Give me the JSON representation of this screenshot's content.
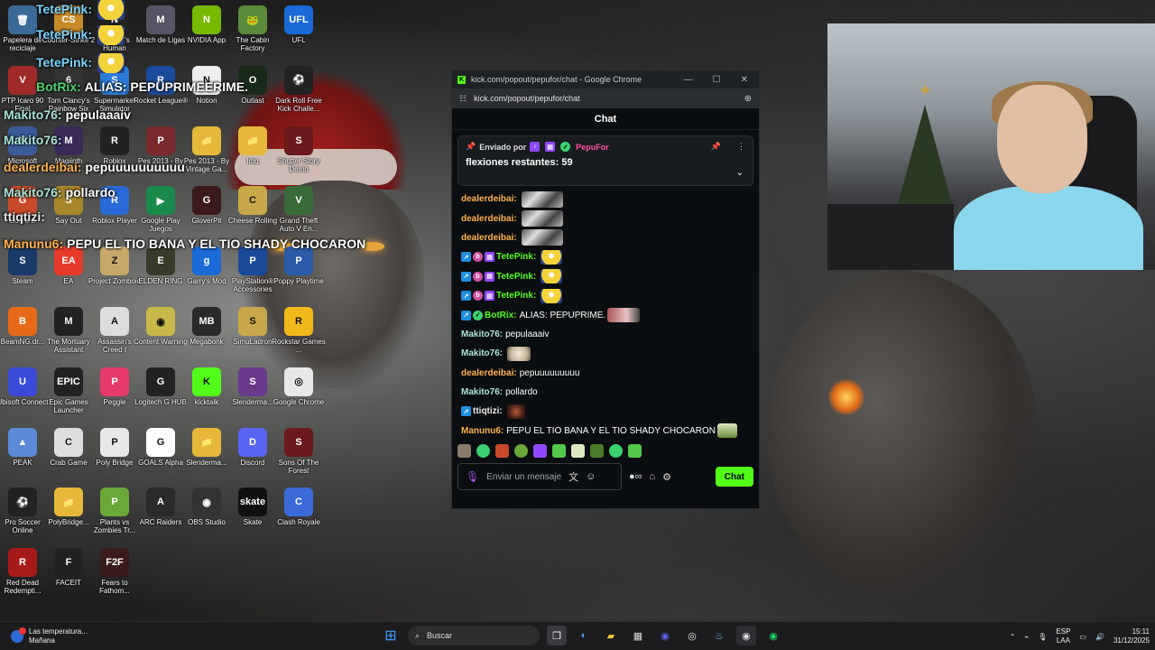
{
  "overlay_chat": [
    {
      "user": "TetePink:",
      "text": "",
      "color": "#7ad6ff",
      "emote": true
    },
    {
      "user": "TetePink:",
      "text": "",
      "color": "#7ad6ff",
      "emote": true
    },
    {
      "user": "TetePink:",
      "text": "",
      "color": "#7ad6ff",
      "emote": true
    },
    {
      "user": "BotRix:",
      "text": "ALIAS: PEPUPRIMEERIME.",
      "color": "#4fd46c"
    },
    {
      "user": "Makito76:",
      "text": "pepulaaaiv",
      "color": "#a9e3d8"
    },
    {
      "user": "Makito76:",
      "text": "",
      "color": "#a9e3d8"
    },
    {
      "user": "dealerdeibai:",
      "text": "pepuuuuuuuuuu",
      "color": "#ffb24d"
    },
    {
      "user": "Makito76:",
      "text": "pollardo",
      "color": "#a9e3d8"
    },
    {
      "user": "ttiqtizi:",
      "text": "",
      "color": "#e8e8e8"
    },
    {
      "user": "Manunu6:",
      "text": "PEPU EL TIO BANA Y EL TIO SHADY CHOCARON",
      "color": "#ffb24d"
    }
  ],
  "desktop_icons": [
    {
      "label": "Papelera de reciclaje",
      "glyph": "🗑",
      "bg": "#3a6a9a"
    },
    {
      "label": "Counter-Strike 2",
      "glyph": "CS",
      "bg": "#c98a2a"
    },
    {
      "label": "No Man's Human",
      "glyph": "N",
      "bg": "#222"
    },
    {
      "label": "Match de Ligas",
      "glyph": "M",
      "bg": "#556"
    },
    {
      "label": "NVIDIA App",
      "glyph": "N",
      "bg": "#76b900"
    },
    {
      "label": "The Cabin Factory",
      "glyph": "🐸",
      "bg": "#5a8a3a"
    },
    {
      "label": "UFL",
      "glyph": "UFL",
      "bg": "#1a6ad8"
    },
    {
      "label": "PTP Icaro 90 Final",
      "glyph": "V",
      "bg": "#a02a2a"
    },
    {
      "label": "Tom Clancy's Rainbow Six",
      "glyph": "6",
      "bg": "#333"
    },
    {
      "label": "Supermarket Simulator",
      "glyph": "S",
      "bg": "#2a7ad8"
    },
    {
      "label": "Rocket League®",
      "glyph": "R",
      "bg": "#1a4a9a"
    },
    {
      "label": "Notion",
      "glyph": "N",
      "bg": "#eee"
    },
    {
      "label": "Outlast",
      "glyph": "O",
      "bg": "#1a2a1a"
    },
    {
      "label": "Dark Roll Free Kick Challe...",
      "glyph": "⚽",
      "bg": "#222"
    },
    {
      "label": "Microsoft",
      "glyph": "M",
      "bg": "#3a5a9a"
    },
    {
      "label": "Magiinth",
      "glyph": "M",
      "bg": "#3a2a5a"
    },
    {
      "label": "Roblox",
      "glyph": "R",
      "bg": "#222"
    },
    {
      "label": "Pes 2013 - By Vin...",
      "glyph": "P",
      "bg": "#7a2a2a"
    },
    {
      "label": "Pes 2013 - By Vintage Ga...",
      "glyph": "📁",
      "bg": "#e6b83a"
    },
    {
      "label": "Img",
      "glyph": "📁",
      "bg": "#e6b83a"
    },
    {
      "label": "Shutter Story Demo",
      "glyph": "S",
      "bg": "#6a1a1a"
    },
    {
      "label": "Guard O",
      "glyph": "G",
      "bg": "#c84a2a"
    },
    {
      "label": "Say Out",
      "glyph": "S",
      "bg": "#a8862a"
    },
    {
      "label": "Roblox Player",
      "glyph": "R",
      "bg": "#2a6ad8"
    },
    {
      "label": "Google Play Juegos",
      "glyph": "▶",
      "bg": "#1a8a4a"
    },
    {
      "label": "GloverPit",
      "glyph": "G",
      "bg": "#3a1a1a"
    },
    {
      "label": "Cheese Rolling",
      "glyph": "C",
      "bg": "#c8a84a"
    },
    {
      "label": "Grand Theft Auto V En...",
      "glyph": "V",
      "bg": "#3a6a3a"
    },
    {
      "label": "Steam",
      "glyph": "S",
      "bg": "#1a3a6a"
    },
    {
      "label": "EA",
      "glyph": "EA",
      "bg": "#e63a2a"
    },
    {
      "label": "Project Zomboid",
      "glyph": "Z",
      "bg": "#c8a86a"
    },
    {
      "label": "ELDEN RING",
      "glyph": "E",
      "bg": "#3a3a2a"
    },
    {
      "label": "Garry's Mod",
      "glyph": "g",
      "bg": "#1a6ad8"
    },
    {
      "label": "PlayStation® Accessories",
      "glyph": "P",
      "bg": "#1a4a9a"
    },
    {
      "label": "Poppy Playtime",
      "glyph": "P",
      "bg": "#2a5aa8"
    },
    {
      "label": "BeamNG.dr...",
      "glyph": "B",
      "bg": "#e66a1a"
    },
    {
      "label": "The Mortuary Assistant",
      "glyph": "M",
      "bg": "#222"
    },
    {
      "label": "Assassin's Creed I",
      "glyph": "A",
      "bg": "#ddd"
    },
    {
      "label": "Content Warning",
      "glyph": "◉",
      "bg": "#c8b84a"
    },
    {
      "label": "Megabonk",
      "glyph": "MB",
      "bg": "#2a2a2a"
    },
    {
      "label": "SimuLadron",
      "glyph": "S",
      "bg": "#c8a84a"
    },
    {
      "label": "Rockstar Games ...",
      "glyph": "R",
      "bg": "#f0b81a"
    },
    {
      "label": "Ubisoft Connect",
      "glyph": "U",
      "bg": "#3a4ad8"
    },
    {
      "label": "Epic Games Launcher",
      "glyph": "EPIC",
      "bg": "#222"
    },
    {
      "label": "Peggle",
      "glyph": "P",
      "bg": "#e63a6a"
    },
    {
      "label": "Logitech G HUB",
      "glyph": "G",
      "bg": "#222"
    },
    {
      "label": "kicktalk",
      "glyph": "K",
      "bg": "#53fc18"
    },
    {
      "label": "Slenderma...",
      "glyph": "S",
      "bg": "#6a3a8a"
    },
    {
      "label": "Google Chrome",
      "glyph": "◎",
      "bg": "#e8e8e8"
    },
    {
      "label": "PEAK",
      "glyph": "▲",
      "bg": "#5a8ad8"
    },
    {
      "label": "Crab Game",
      "glyph": "C",
      "bg": "#ddd"
    },
    {
      "label": "Poly Bridge",
      "glyph": "P",
      "bg": "#e8e8e8"
    },
    {
      "label": "GOALS Alpha",
      "glyph": "G",
      "bg": "#fff"
    },
    {
      "label": "Slenderma...",
      "glyph": "📁",
      "bg": "#e6b83a"
    },
    {
      "label": "Discord",
      "glyph": "D",
      "bg": "#5865f2"
    },
    {
      "label": "Sons Of The Forest",
      "glyph": "S",
      "bg": "#6a1a1a"
    },
    {
      "label": "Pro Soccer Online",
      "glyph": "⚽",
      "bg": "#222"
    },
    {
      "label": "PolyBridge...",
      "glyph": "📁",
      "bg": "#e6b83a"
    },
    {
      "label": "Plants vs Zombies Tr...",
      "glyph": "P",
      "bg": "#6aa83a"
    },
    {
      "label": "ARC Raiders",
      "glyph": "A",
      "bg": "#2a2a2a"
    },
    {
      "label": "OBS Studio",
      "glyph": "◉",
      "bg": "#333"
    },
    {
      "label": "Skate",
      "glyph": "skate",
      "bg": "#111"
    },
    {
      "label": "Clash Royale",
      "glyph": "C",
      "bg": "#3a6ad8"
    },
    {
      "label": "Red Dead Redempti...",
      "glyph": "R",
      "bg": "#a81a1a"
    },
    {
      "label": "FACEIT",
      "glyph": "F",
      "bg": "#222"
    },
    {
      "label": "Fears to Fathom...",
      "glyph": "F2F",
      "bg": "#3a1a1a"
    }
  ],
  "window": {
    "title": "kick.com/popout/pepufor/chat - Google Chrome",
    "url": "kick.com/popout/pepufor/chat",
    "header": "Chat",
    "pinned": {
      "sent_by": "Enviado por",
      "author": "PepuFor",
      "message": "flexiones restantes: 59"
    },
    "messages": [
      {
        "user": "dealerdeibai:",
        "text": "",
        "color": "#ffb24d",
        "emote": "gray",
        "badges": []
      },
      {
        "user": "dealerdeibai:",
        "text": "",
        "color": "#ffb24d",
        "emote": "gray",
        "badges": []
      },
      {
        "user": "dealerdeibai:",
        "text": "",
        "color": "#ffb24d",
        "emote": "gray",
        "badges": []
      },
      {
        "user": "TetePink:",
        "text": "",
        "color": "#53fc18",
        "emote": "minion",
        "badges": [
          "blue",
          "pink",
          "purple"
        ]
      },
      {
        "user": "TetePink:",
        "text": "",
        "color": "#53fc18",
        "emote": "minion",
        "badges": [
          "blue",
          "pink",
          "purple"
        ]
      },
      {
        "user": "TetePink:",
        "text": "",
        "color": "#53fc18",
        "emote": "minion",
        "badges": [
          "blue",
          "pink",
          "purple"
        ]
      },
      {
        "user": "BotRix:",
        "text": "ALIAS: PEPUPRIME.",
        "color": "#53fc18",
        "emote": "pink",
        "badges": [
          "blue",
          "green"
        ]
      },
      {
        "user": "Makito76:",
        "text": "pepulaaaiv",
        "color": "#a9e3d8",
        "emote": "",
        "badges": []
      },
      {
        "user": "Makito76:",
        "text": "",
        "color": "#a9e3d8",
        "emote": "dog",
        "badges": []
      },
      {
        "user": "dealerdeibai:",
        "text": "pepuuuuuuuuu",
        "color": "#ffb24d",
        "emote": "",
        "badges": []
      },
      {
        "user": "Makito76:",
        "text": "pollardo",
        "color": "#a9e3d8",
        "emote": "",
        "badges": []
      },
      {
        "user": "ttiqtizi:",
        "text": "",
        "color": "#e8e8e8",
        "emote": "tiny",
        "badges": [
          "blue"
        ]
      },
      {
        "user": "Manunu6:",
        "text": "PEPU EL TIO BANA Y EL TIO SHADY CHOCARON",
        "color": "#ffb24d",
        "emote": "smug",
        "badges": []
      }
    ],
    "input_placeholder": "Enviar un mensaje",
    "send_label": "Chat"
  },
  "taskbar": {
    "weather_line1": "Las temperatura...",
    "weather_line2": "Mañana",
    "weather_badge": "4",
    "search_placeholder": "Buscar",
    "lang_line1": "ESP",
    "lang_line2": "LAA",
    "time": "15:11",
    "date": "31/12/2025"
  },
  "colors": {
    "kick_green": "#53fc18",
    "pin_author": "#ff4fa0"
  }
}
